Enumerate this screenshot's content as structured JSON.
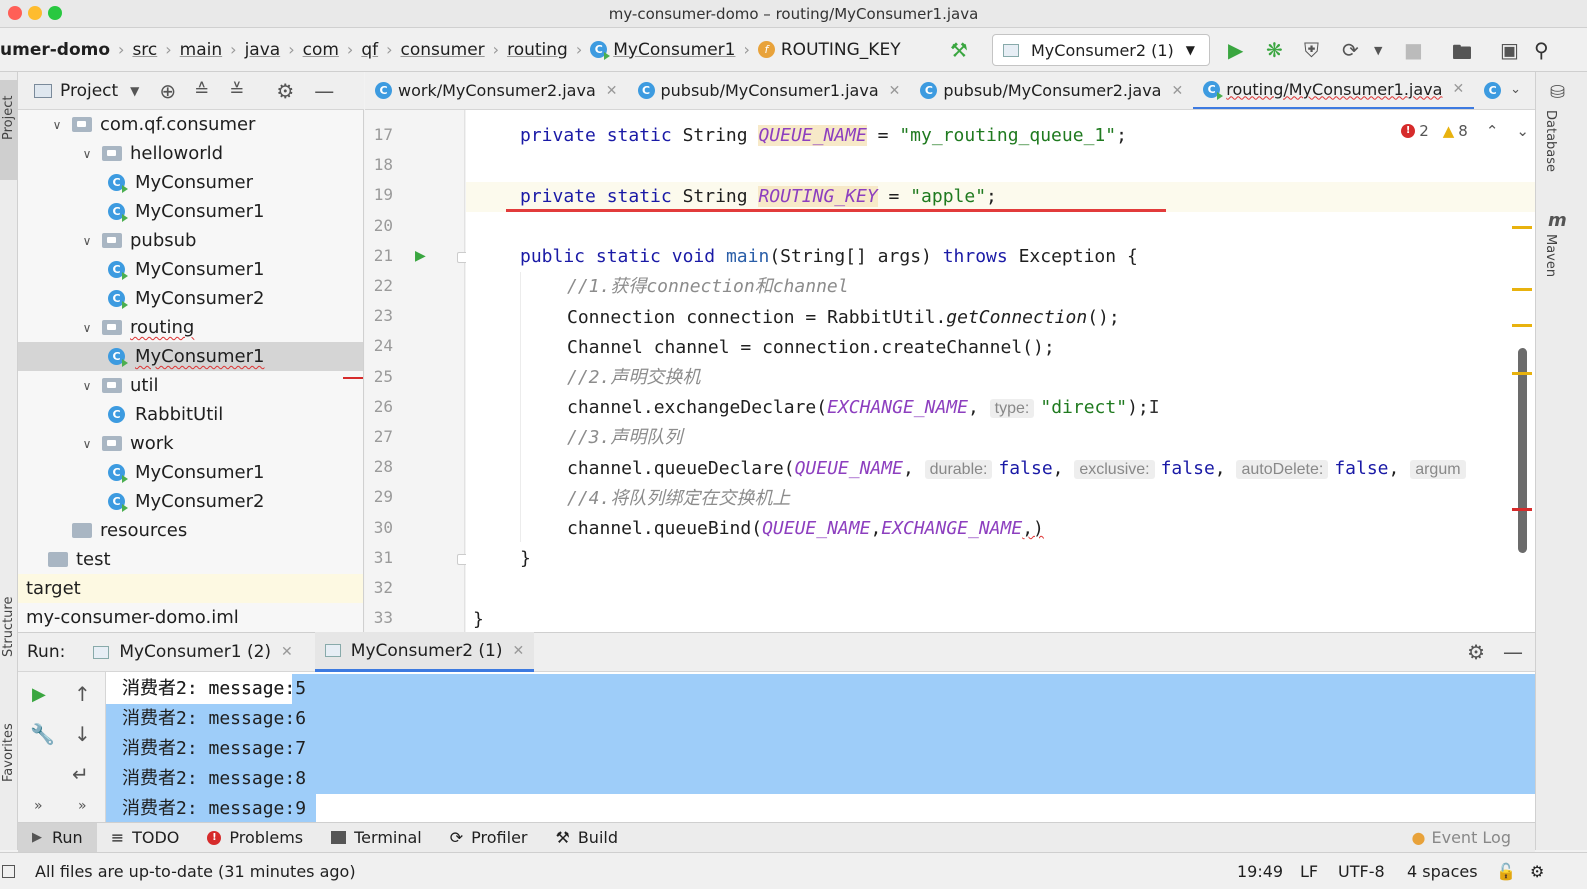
{
  "window": {
    "title": "my-consumer-domo – routing/MyConsumer1.java"
  },
  "navbar": {
    "crumbs": [
      "umer-domo",
      "src",
      "main",
      "java",
      "com",
      "qf",
      "consumer",
      "routing",
      "MyConsumer1",
      "ROUTING_KEY"
    ],
    "run_config": "MyConsumer2 (1)"
  },
  "project_panel": {
    "title": "Project",
    "tree": [
      {
        "label": "com.qf.consumer",
        "kind": "package",
        "level": 1,
        "expanded": true
      },
      {
        "label": "helloworld",
        "kind": "package",
        "level": 2,
        "expanded": true
      },
      {
        "label": "MyConsumer",
        "kind": "class-run",
        "level": 3
      },
      {
        "label": "MyConsumer1",
        "kind": "class-run",
        "level": 3
      },
      {
        "label": "pubsub",
        "kind": "package",
        "level": 2,
        "expanded": true
      },
      {
        "label": "MyConsumer1",
        "kind": "class-run",
        "level": 3
      },
      {
        "label": "MyConsumer2",
        "kind": "class-run",
        "level": 3
      },
      {
        "label": "routing",
        "kind": "package",
        "level": 2,
        "expanded": true
      },
      {
        "label": "MyConsumer1",
        "kind": "class-run",
        "level": 3,
        "selected": true
      },
      {
        "label": "util",
        "kind": "package",
        "level": 2,
        "expanded": true
      },
      {
        "label": "RabbitUtil",
        "kind": "class",
        "level": 3
      },
      {
        "label": "work",
        "kind": "package",
        "level": 2,
        "expanded": true
      },
      {
        "label": "MyConsumer1",
        "kind": "class-run",
        "level": 3
      },
      {
        "label": "MyConsumer2",
        "kind": "class-run",
        "level": 3
      },
      {
        "label": "resources",
        "kind": "folder",
        "level": 1
      },
      {
        "label": "test",
        "kind": "folder",
        "level": 0
      },
      {
        "label": "target",
        "kind": "plain",
        "level": 0
      },
      {
        "label": "my-consumer-domo.iml",
        "kind": "plain",
        "level": 0
      }
    ]
  },
  "editor_tabs": [
    {
      "label": "work/MyConsumer2.java",
      "active": false
    },
    {
      "label": "pubsub/MyConsumer1.java",
      "active": false
    },
    {
      "label": "pubsub/MyConsumer2.java",
      "active": false
    },
    {
      "label": "routing/MyConsumer1.java",
      "active": true
    }
  ],
  "inspections": {
    "errors": "2",
    "warnings": "8"
  },
  "code": {
    "line_numbers": [
      "17",
      "18",
      "19",
      "20",
      "21",
      "22",
      "23",
      "24",
      "25",
      "26",
      "27",
      "28",
      "29",
      "30",
      "31",
      "32",
      "33"
    ],
    "kw_private": "private",
    "kw_static": "static",
    "kw_public": "public",
    "kw_void": "void",
    "kw_throws": "throws",
    "type_string": "String",
    "queue_name_const": "QUEUE_NAME",
    "queue_name_value": "\"my_routing_queue_1\"",
    "routing_key_const": "ROUTING_KEY",
    "routing_key_value": "\"apple\"",
    "main_sig_1": "main",
    "main_sig_2": "(String[] args) ",
    "main_sig_3": " Exception {",
    "comment_1": "//1.获得connection和channel",
    "line_23_a": "Connection connection = RabbitUtil.",
    "line_23_b": "getConnection",
    "line_23_c": "();",
    "line_24": "Channel channel = connection.createChannel();",
    "comment_2": "//2.声明交换机",
    "line_26_a": "channel.exchangeDeclare(",
    "exchange_name_const": "EXCHANGE_NAME",
    "hint_type": "type:",
    "line_26_str": "\"direct\"",
    "line_26_end": ");",
    "comment_3": "//3.声明队列",
    "line_28_a": "channel.queueDeclare(",
    "hint_durable": "durable:",
    "hint_exclusive": "exclusive:",
    "hint_autodelete": "autoDelete:",
    "hint_argum": "argum",
    "kw_false": "false",
    "comment_4": "//4.将队列绑定在交换机上",
    "line_30_a": "channel.queueBind(",
    "line_30_end": ",)",
    "close_brace_method": "}",
    "close_brace_class": "}"
  },
  "run_panel": {
    "label": "Run:",
    "tabs": [
      {
        "label": "MyConsumer1 (2)",
        "active": false
      },
      {
        "label": "MyConsumer2 (1)",
        "active": true
      }
    ],
    "output": [
      "消费者2: message:5",
      "消费者2: message:6",
      "消费者2: message:7",
      "消费者2: message:8",
      "消费者2: message:9"
    ]
  },
  "tool_windows": [
    "Run",
    "TODO",
    "Problems",
    "Terminal",
    "Profiler",
    "Build"
  ],
  "event_log": "Event Log",
  "status": {
    "message": "All files are up-to-date (31 minutes ago)",
    "position": "19:49",
    "line_sep": "LF",
    "encoding": "UTF-8",
    "indent": "4 spaces"
  },
  "side_strips": {
    "project": "Project",
    "structure": "Structure",
    "favorites": "Favorites",
    "database": "Database",
    "maven": "Maven"
  },
  "colors": {
    "accent": "#3d7ae0",
    "run_green": "#3aa640",
    "error_red": "#d62b2b",
    "warning_yellow": "#e8b20e",
    "selection_blue": "#9ecdf9"
  }
}
